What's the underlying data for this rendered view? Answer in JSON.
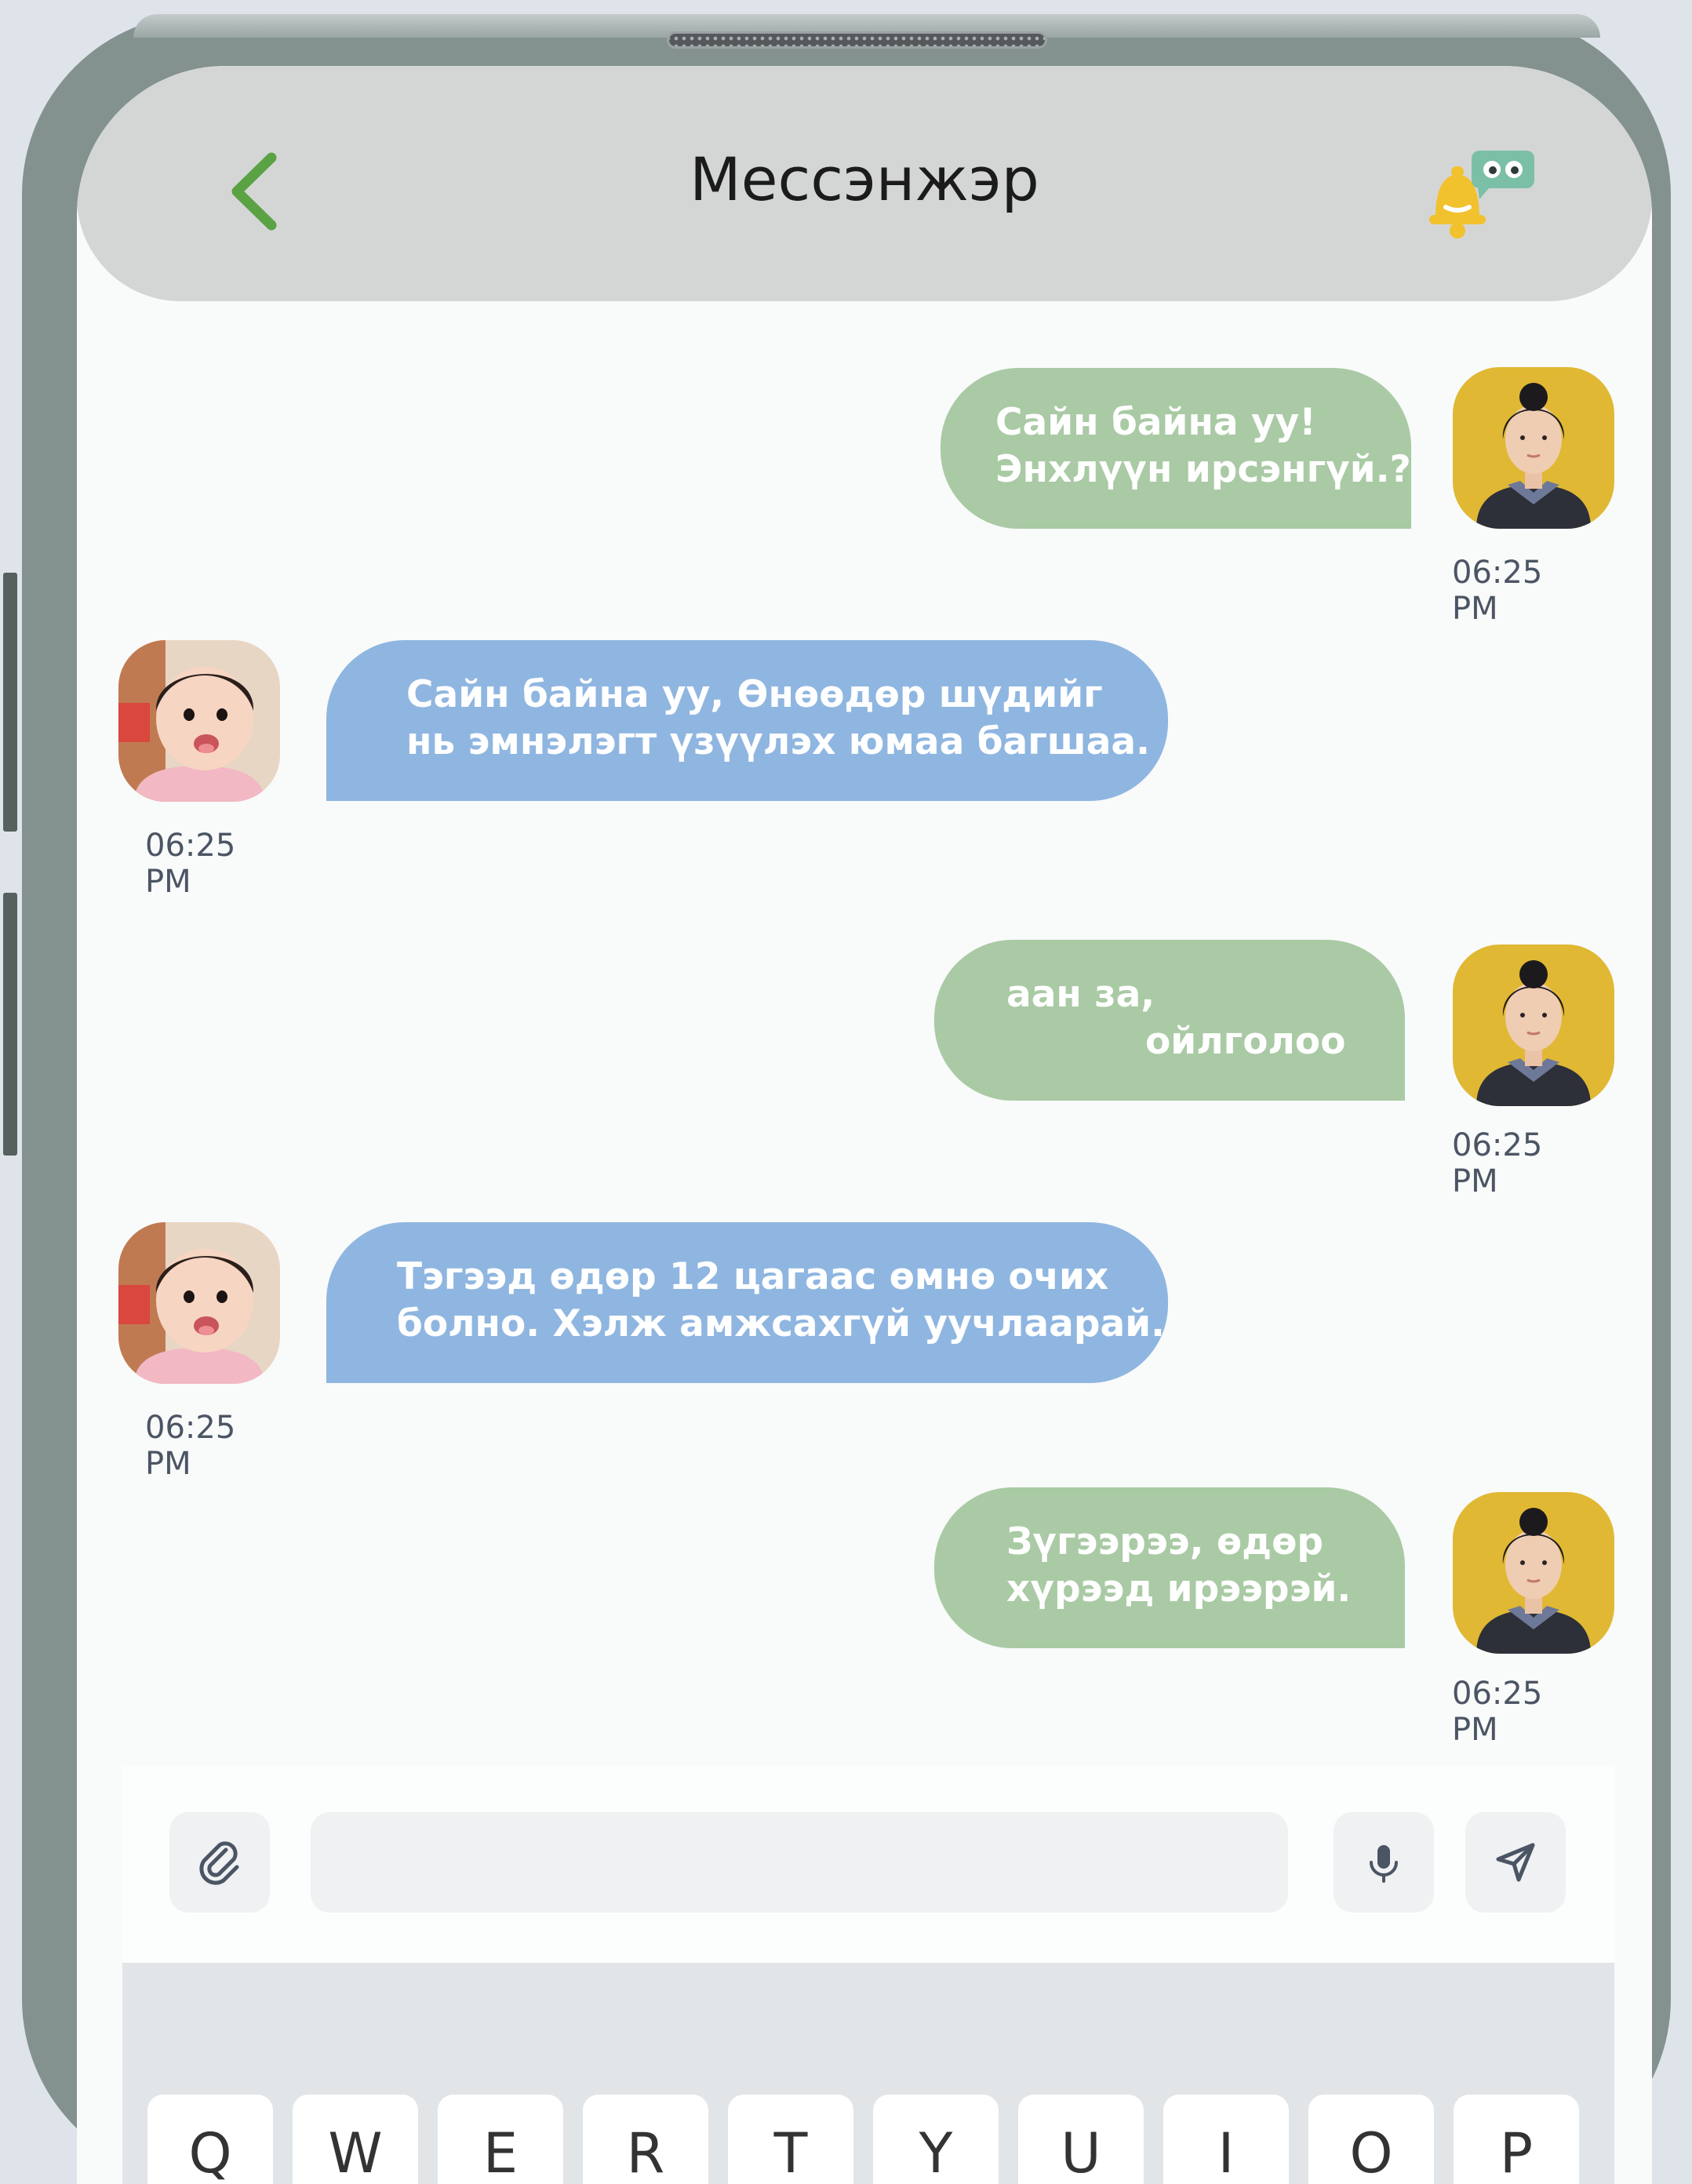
{
  "header": {
    "title": "Мессэнжэр",
    "back_icon": "chevron-left-icon",
    "notification_icon": "bell-chat-icon"
  },
  "colors": {
    "outgoing_bubble": "#a9caa4",
    "incoming_bubble": "#8fb6e0",
    "header_bg": "#d4d6d6",
    "back_arrow": "#5aa243",
    "bell": "#f2c12e",
    "chat_badge": "#7cbfa7"
  },
  "messages": [
    {
      "direction": "outgoing",
      "lines": [
        "Сайн байна уу!",
        "Энхлүүн ирсэнгүй.?"
      ],
      "time": "06:25 PM",
      "sender": "teacher"
    },
    {
      "direction": "incoming",
      "lines": [
        "Сайн байна уу, Өнөөдөр шүдийг",
        "нь эмнэлэгт үзүүлэх юмаа багшаа."
      ],
      "time": "06:25 PM",
      "sender": "child"
    },
    {
      "direction": "outgoing",
      "lines": [
        "аан за,",
        "ойлголоо"
      ],
      "time": "06:25 PM",
      "sender": "teacher"
    },
    {
      "direction": "incoming",
      "lines": [
        "Тэгээд өдөр 12 цагаас өмнө очих",
        "болно. Хэлж амжсахгүй уучлаарай."
      ],
      "time": "06:25 PM",
      "sender": "child"
    },
    {
      "direction": "outgoing",
      "lines": [
        "Зүгээрээ, өдөр",
        "хүрээд ирээрэй."
      ],
      "time": "06:25 PM",
      "sender": "teacher"
    }
  ],
  "composer": {
    "attach_icon": "paperclip-icon",
    "input_value": "",
    "input_placeholder": "",
    "mic_icon": "microphone-icon",
    "send_icon": "send-icon"
  },
  "keyboard": {
    "top_row": [
      "Q",
      "W",
      "E",
      "R",
      "T",
      "Y",
      "U",
      "I",
      "O",
      "P"
    ]
  }
}
